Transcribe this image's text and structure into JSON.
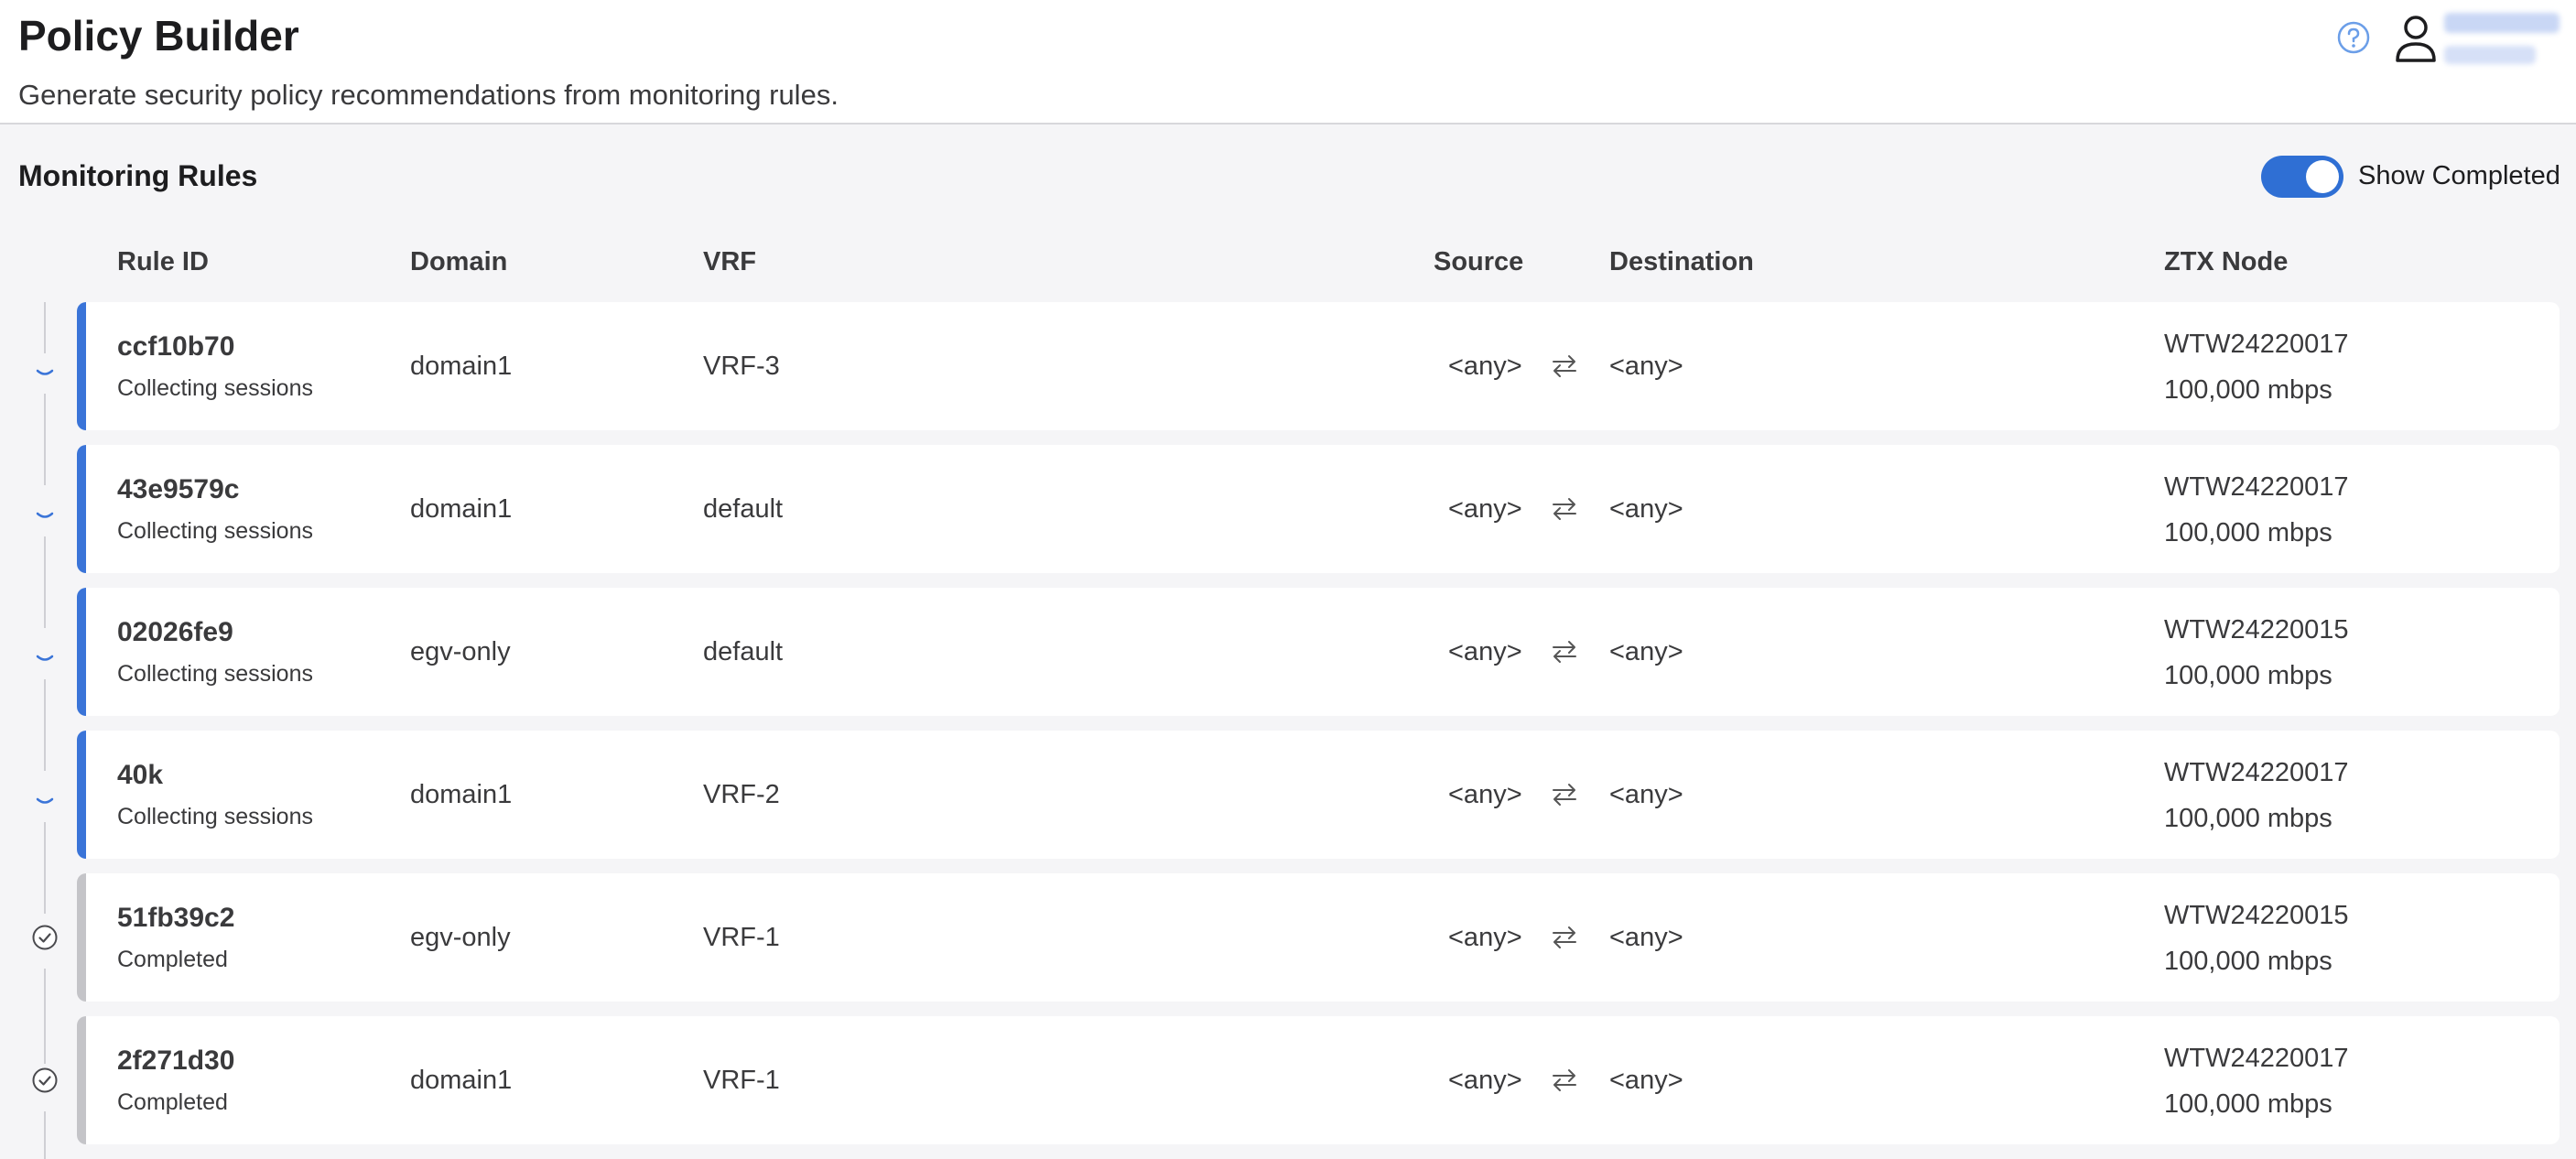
{
  "header": {
    "title": "Policy Builder",
    "subtitle": "Generate security policy recommendations from monitoring rules."
  },
  "section": {
    "title": "Monitoring Rules",
    "toggle_label": "Show Completed",
    "toggle_on": true
  },
  "columns": {
    "rule_id": "Rule ID",
    "domain": "Domain",
    "vrf": "VRF",
    "source": "Source",
    "destination": "Destination",
    "ztx_node": "ZTX Node"
  },
  "colors": {
    "accent": "#2f6fd4",
    "collecting": "#3a74d8",
    "completed": "#c4c4c8"
  },
  "rows": [
    {
      "rule_id": "ccf10b70",
      "status": "Collecting sessions",
      "state": "collecting",
      "domain": "domain1",
      "vrf": "VRF-3",
      "source": "<any>",
      "destination": "<any>",
      "node": "WTW24220017",
      "speed": "100,000 mbps"
    },
    {
      "rule_id": "43e9579c",
      "status": "Collecting sessions",
      "state": "collecting",
      "domain": "domain1",
      "vrf": "default",
      "source": "<any>",
      "destination": "<any>",
      "node": "WTW24220017",
      "speed": "100,000 mbps"
    },
    {
      "rule_id": "02026fe9",
      "status": "Collecting sessions",
      "state": "collecting",
      "domain": "egv-only",
      "vrf": "default",
      "source": "<any>",
      "destination": "<any>",
      "node": "WTW24220015",
      "speed": "100,000 mbps"
    },
    {
      "rule_id": "40k",
      "status": "Collecting sessions",
      "state": "collecting",
      "domain": "domain1",
      "vrf": "VRF-2",
      "source": "<any>",
      "destination": "<any>",
      "node": "WTW24220017",
      "speed": "100,000 mbps"
    },
    {
      "rule_id": "51fb39c2",
      "status": "Completed",
      "state": "completed",
      "domain": "egv-only",
      "vrf": "VRF-1",
      "source": "<any>",
      "destination": "<any>",
      "node": "WTW24220015",
      "speed": "100,000 mbps"
    },
    {
      "rule_id": "2f271d30",
      "status": "Completed",
      "state": "completed",
      "domain": "domain1",
      "vrf": "VRF-1",
      "source": "<any>",
      "destination": "<any>",
      "node": "WTW24220017",
      "speed": "100,000 mbps"
    }
  ]
}
